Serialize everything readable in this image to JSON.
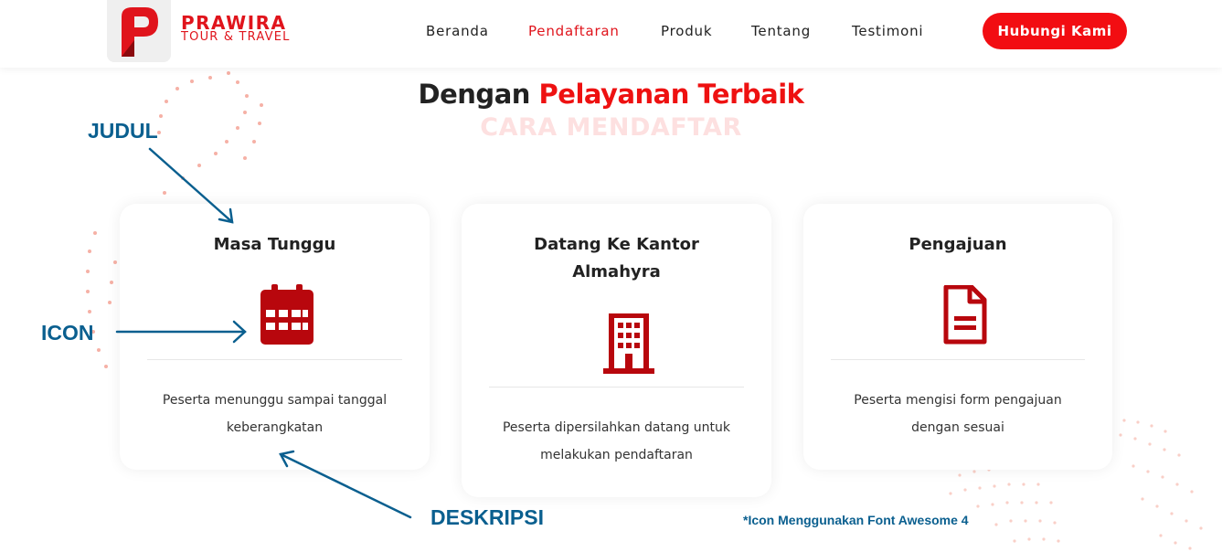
{
  "brand": {
    "name": "PRAWIRA",
    "subtitle": "TOUR & TRAVEL",
    "logo_letter": "P",
    "color": "#e0141c"
  },
  "nav": {
    "items": [
      {
        "label": "Beranda",
        "active": false
      },
      {
        "label": "Pendaftaran",
        "active": true
      },
      {
        "label": "Produk",
        "active": false
      },
      {
        "label": "Tentang",
        "active": false
      },
      {
        "label": "Testimoni",
        "active": false
      }
    ],
    "cta_label": "Hubungi Kami"
  },
  "section": {
    "heading_plain": "Dengan ",
    "heading_highlight": "Pelayanan Terbaik",
    "ghost_text": "CARA MENDAFTAR"
  },
  "cards": [
    {
      "title": "Masa Tunggu",
      "icon": "calendar-icon",
      "desc_line1": "Peserta menunggu sampai tanggal",
      "desc_line2": "keberangkatan"
    },
    {
      "title_line1": "Datang Ke Kantor",
      "title_line2": "Almahyra",
      "icon": "building-icon",
      "desc_line1": "Peserta dipersilahkan datang untuk",
      "desc_line2": "melakukan pendaftaran"
    },
    {
      "title": "Pengajuan",
      "icon": "file-text-icon",
      "desc_line1": "Peserta mengisi form pengajuan",
      "desc_line2": "dengan sesuai"
    }
  ],
  "annotations": {
    "judul": "JUDUL",
    "icon": "ICON",
    "deskripsi": "DESKRIPSI",
    "note": "*Icon Menggunakan Font Awesome 4"
  },
  "colors": {
    "accent": "#e0141c",
    "icon_red": "#b8070d",
    "annotation_blue": "#0a5f8f"
  }
}
